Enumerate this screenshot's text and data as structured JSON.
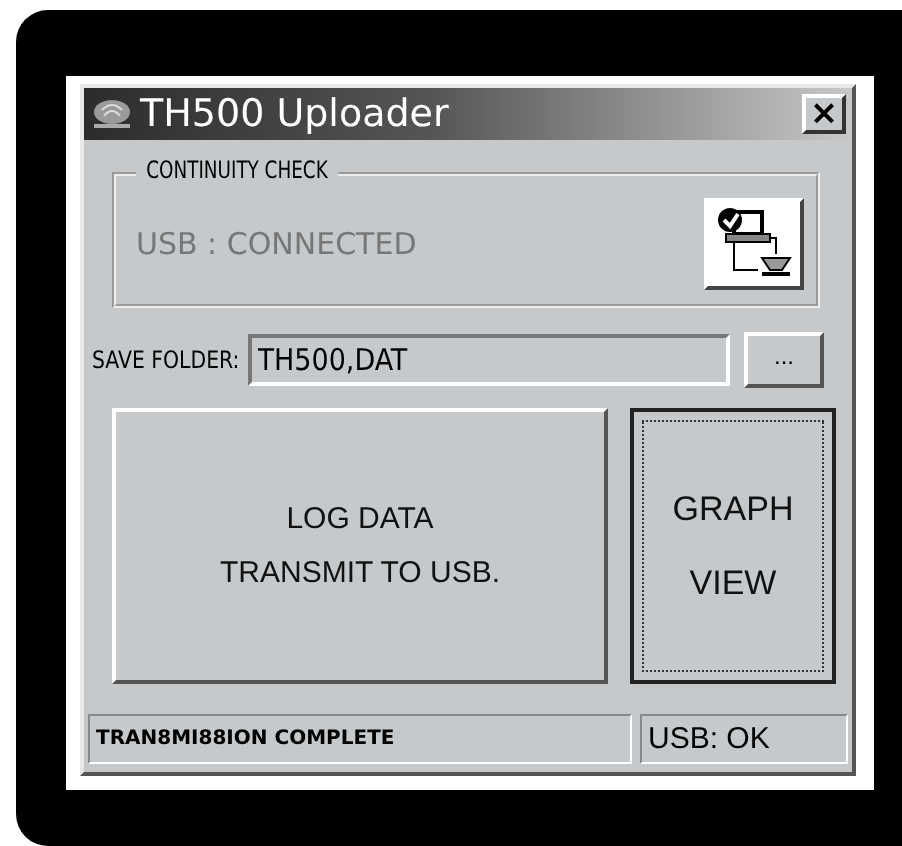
{
  "window": {
    "title": "TH500 Uploader",
    "close": "×"
  },
  "continuity_check": {
    "title": "CONTINUITY CHECK",
    "status": "USB : CONNECTED"
  },
  "save_folder": {
    "label": "SAVE FOLDER:",
    "value": "TH500,DAT",
    "browse": "..."
  },
  "buttons": [
    {
      "label_lines": [
        "LOG  DATA",
        "TRANSMIT TO USB."
      ],
      "focused": false
    },
    {
      "label_lines": [
        "GRAPH",
        "VIEW"
      ],
      "focused": true
    }
  ],
  "status_bar": [
    "TRAN8MI88ION COMPLETE",
    "USB: OK"
  ]
}
